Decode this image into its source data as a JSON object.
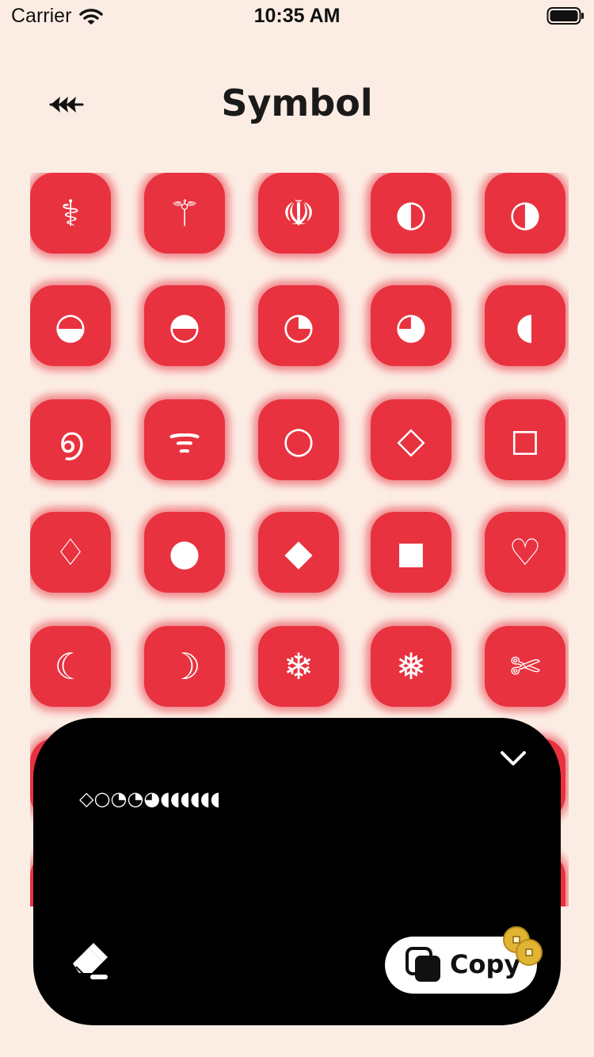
{
  "status_bar": {
    "carrier": "Carrier",
    "time": "10:35 AM"
  },
  "header": {
    "title": "Symbol"
  },
  "symbols": [
    "⚕",
    "⚚",
    "☫",
    "◐",
    "◑",
    "◒",
    "◓",
    "◔",
    "◕",
    "◖",
    "൭",
    "ᯤ",
    "○",
    "◇",
    "◻",
    "♢",
    "●",
    "◆",
    "◼",
    "♡",
    "☾",
    "☽",
    "❄",
    "❅",
    "✄"
  ],
  "composer": {
    "text": "◇○◔◔◕◖◖◖◖◖◖",
    "copy_label": "Copy"
  },
  "colors": {
    "background": "#fcede4",
    "tile": "#e8323f",
    "sheet": "#000000",
    "coin": "#e0b534"
  }
}
